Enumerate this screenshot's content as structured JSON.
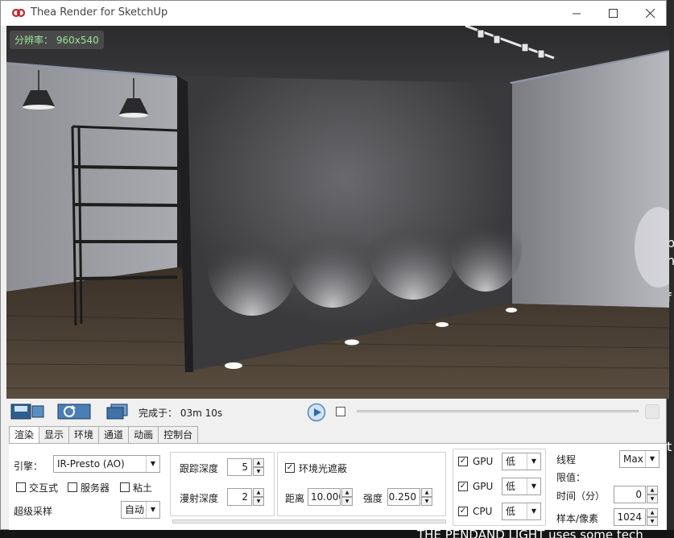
{
  "window": {
    "title": "Thea Render for SketchUp"
  },
  "viewport": {
    "resolution_label": "分辨率：",
    "resolution_value": "960x540"
  },
  "toolbar": {
    "render_done_label": "完成于：",
    "render_time": "03m 10s"
  },
  "tabs": [
    "渲染",
    "显示",
    "环境",
    "通道",
    "动画",
    "控制台"
  ],
  "engine": {
    "label": "引擎：",
    "value": "IR-Presto (AO)",
    "interactive_label": "交互式",
    "server_label": "服务器",
    "clay_label": "粘土",
    "supersampling_label": "超级采样",
    "supersampling_value": "自动"
  },
  "depth": {
    "trace_label": "跟踪深度",
    "trace_value": "5",
    "diffuse_label": "漫射深度",
    "diffuse_value": "2"
  },
  "ao": {
    "enabled_label": "环境光遮蔽",
    "distance_label": "距离",
    "distance_value": "10.000",
    "intensity_label": "强度",
    "intensity_value": "0.250"
  },
  "devices": [
    {
      "name": "GPU",
      "level": "低"
    },
    {
      "name": "GPU",
      "level": "低"
    },
    {
      "name": "CPU",
      "level": "低"
    }
  ],
  "limits": {
    "threads_label": "线程",
    "threads_value": "Max",
    "limit_label": "限值：",
    "time_label": "时间（分）",
    "time_value": "0",
    "samples_label": "样本/像素",
    "samples_value": "1024"
  },
  "background": {
    "bottom_text": "THE PENDAND LIGHT uses some tech",
    "right_chars": [
      "i",
      "p",
      "n",
      "f",
      "l",
      "t"
    ]
  },
  "colors": {
    "badge_text": "#9ee39e",
    "wall": "#3a3a3c",
    "floor": "#4a4036"
  }
}
